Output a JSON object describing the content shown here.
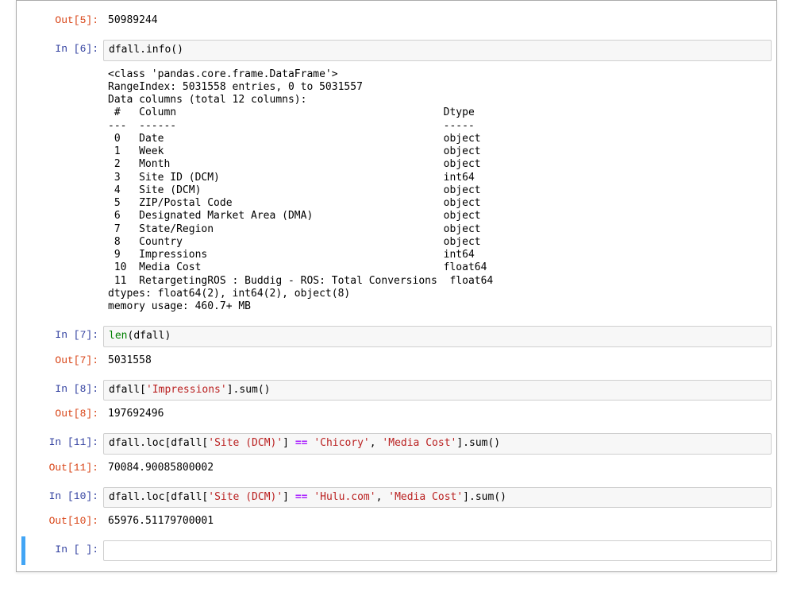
{
  "cells": {
    "out5": {
      "prompt": "Out[5]:",
      "text": "50989244"
    },
    "in6": {
      "prompt": "In [6]:",
      "code_parts": {
        "obj": "dfall",
        "dot1": ".",
        "method": "info",
        "paren": "()"
      }
    },
    "out6": {
      "text": "<class 'pandas.core.frame.DataFrame'>\nRangeIndex: 5031558 entries, 0 to 5031557\nData columns (total 12 columns):\n #   Column                                           Dtype  \n---  ------                                           -----  \n 0   Date                                             object \n 1   Week                                             object \n 2   Month                                            object \n 3   Site ID (DCM)                                    int64  \n 4   Site (DCM)                                       object \n 5   ZIP/Postal Code                                  object \n 6   Designated Market Area (DMA)                     object \n 7   State/Region                                     object \n 8   Country                                          object \n 9   Impressions                                      int64  \n 10  Media Cost                                       float64\n 11  RetargetingROS : Buddig - ROS: Total Conversions  float64\ndtypes: float64(2), int64(2), object(8)\nmemory usage: 460.7+ MB"
    },
    "in7": {
      "prompt": "In [7]:",
      "code_parts": {
        "builtin": "len",
        "open": "(",
        "arg": "dfall",
        "close": ")"
      }
    },
    "out7": {
      "prompt": "Out[7]:",
      "text": "5031558"
    },
    "in8": {
      "prompt": "In [8]:",
      "code_parts": {
        "obj": "dfall",
        "br1": "[",
        "str1": "'Impressions'",
        "br2": "]",
        "dot": ".",
        "method": "sum",
        "paren": "()"
      }
    },
    "out8": {
      "prompt": "Out[8]:",
      "text": "197692496"
    },
    "in11": {
      "prompt": "In [11]:",
      "code_parts": {
        "p1": "dfall",
        "dot1": ".",
        "loc": "loc",
        "b1": "[",
        "p2": "dfall",
        "b2": "[",
        "s1": "'Site (DCM)'",
        "b3": "]",
        "sp1": " ",
        "eq": "==",
        "sp2": " ",
        "s2": "'Chicory'",
        "c1": ",",
        "sp3": " ",
        "s3": "'Media Cost'",
        "b4": "]",
        "dot2": ".",
        "sum": "sum",
        "paren": "()"
      }
    },
    "out11": {
      "prompt": "Out[11]:",
      "text": "70084.90085800002"
    },
    "in10": {
      "prompt": "In [10]:",
      "code_parts": {
        "p1": "dfall",
        "dot1": ".",
        "loc": "loc",
        "b1": "[",
        "p2": "dfall",
        "b2": "[",
        "s1": "'Site (DCM)'",
        "b3": "]",
        "sp1": " ",
        "eq": "==",
        "sp2": " ",
        "s2": "'Hulu.com'",
        "c1": ",",
        "sp3": " ",
        "s3": "'Media Cost'",
        "b4": "]",
        "dot2": ".",
        "sum": "sum",
        "paren": "()"
      }
    },
    "out10": {
      "prompt": "Out[10]:",
      "text": "65976.51179700001"
    },
    "inEmpty": {
      "prompt": "In [ ]:",
      "code": ""
    }
  }
}
